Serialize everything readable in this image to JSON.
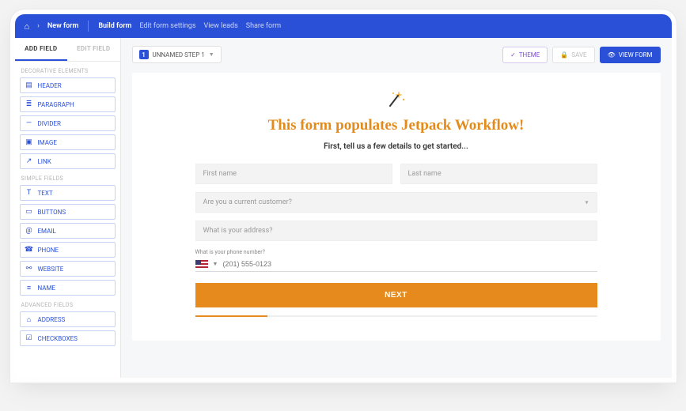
{
  "topbar": {
    "breadcrumb": "New form",
    "nav": {
      "build": "Build form",
      "settings": "Edit form settings",
      "leads": "View leads",
      "share": "Share form"
    }
  },
  "sidebar": {
    "tabs": {
      "add": "ADD FIELD",
      "edit": "EDIT FIELD"
    },
    "groups": {
      "decorative": "DECORATIVE ELEMENTS",
      "simple": "SIMPLE FIELDS",
      "advanced": "ADVANCED FIELDS"
    },
    "items": {
      "header": "HEADER",
      "paragraph": "PARAGRAPH",
      "divider": "DIVIDER",
      "image": "IMAGE",
      "link": "LINK",
      "text": "TEXT",
      "buttons": "BUTTONS",
      "email": "EMAIL",
      "phone": "PHONE",
      "website": "WEBSITE",
      "name": "NAME",
      "address": "ADDRESS",
      "checkboxes": "CHECKBOXES"
    }
  },
  "toolbar": {
    "step_number": "1",
    "step_label": "UNNAMED STEP 1",
    "theme": "THEME",
    "save": "SAVE",
    "view": "VIEW FORM"
  },
  "form": {
    "title": "This form populates Jetpack Workflow!",
    "subtitle": "First, tell us a few details to get started...",
    "first_name_ph": "First name",
    "last_name_ph": "Last name",
    "customer_ph": "Are you a current customer?",
    "address_ph": "What is your address?",
    "phone_label": "What is your phone number?",
    "phone_ph": "(201) 555-0123",
    "next": "NEXT"
  }
}
